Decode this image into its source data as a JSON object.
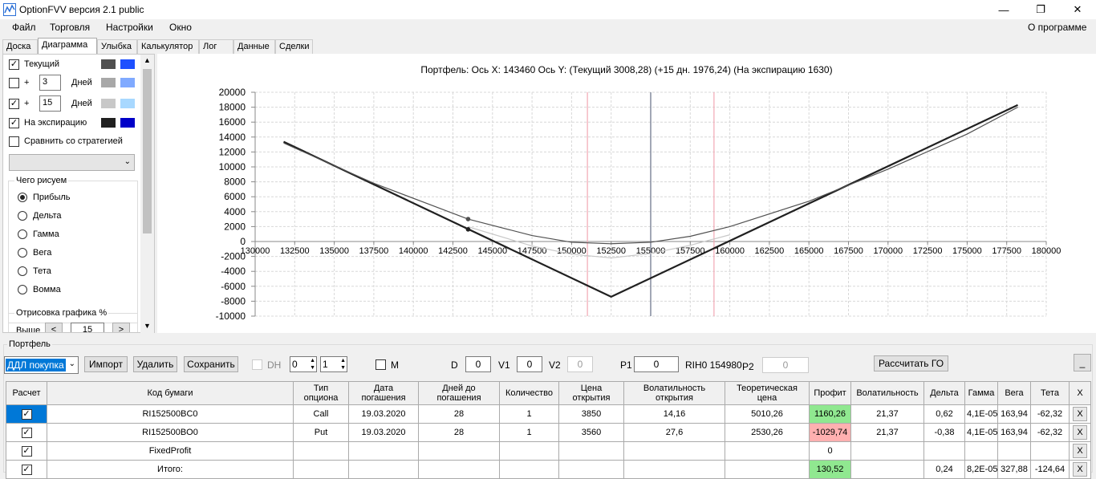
{
  "window": {
    "title": "OptionFVV версия 2.1 public",
    "min": "—",
    "restore": "❐",
    "close": "✕"
  },
  "menu": {
    "items": [
      "Файл",
      "Торговля",
      "Настройки",
      "Окно"
    ],
    "about": "О программе"
  },
  "tabs": [
    "Доска",
    "Диаграмма",
    "Улыбка",
    "Калькулятор",
    "Лог",
    "Данные",
    "Сделки"
  ],
  "left": {
    "current_label": "Текущий",
    "plus": "+",
    "days_label": "Дней",
    "days1": "3",
    "days2": "15",
    "expiry_label": "На экспирацию",
    "compare_label": "Сравнить со стратегией",
    "draw_group": "Чего рисуем",
    "radios": [
      "Прибыль",
      "Дельта",
      "Гамма",
      "Вега",
      "Тета",
      "Вомма"
    ],
    "render_group": "Отрисовка графика %",
    "above_label": "Выше",
    "above_value": "15",
    "lt": "<",
    "gt": ">"
  },
  "colors": {
    "cur_dark": "#505050",
    "cur_light": "#1e50ff",
    "d3_dark": "#a8a8a8",
    "d3_light": "#80aaff",
    "d15_dark": "#c8c8c8",
    "d15_light": "#a8d8ff",
    "exp_dark": "#202020",
    "exp_light": "#0000c8",
    "profit_pos": "#90e890",
    "profit_neg": "#ffb0b0",
    "select_blue": "#0078d7"
  },
  "chart_data": {
    "type": "line",
    "title": "Портфель: Ось X: 143460 Ось Y:  (Текущий 3008,28)  (+15 дн. 1976,24)  (На экспирацию 1630)",
    "xlim": [
      130000,
      180000
    ],
    "ylim": [
      -10000,
      20000
    ],
    "xticks": [
      130000,
      132500,
      135000,
      137500,
      140000,
      142500,
      145000,
      147500,
      150000,
      152500,
      155000,
      157500,
      160000,
      162500,
      165000,
      167500,
      170000,
      172500,
      175000,
      177500,
      180000
    ],
    "yticks": [
      20000,
      18000,
      16000,
      14000,
      12000,
      10000,
      8000,
      6000,
      4000,
      2000,
      0,
      -2000,
      -4000,
      -6000,
      -8000,
      -10000
    ],
    "grid": true,
    "cursor_x": 143460,
    "current_price_x": 155000,
    "vlines": [
      151000,
      159000
    ],
    "series": [
      {
        "name": "На экспирацию",
        "x": [
          131800,
          152500,
          178200
        ],
        "y": [
          13370,
          -7410,
          18290
        ]
      },
      {
        "name": "Текущий",
        "x": [
          131800,
          137500,
          143460,
          147500,
          150000,
          152500,
          155000,
          157500,
          160000,
          165000,
          170000,
          175000,
          178200
        ],
        "y": [
          13200,
          7800,
          3008,
          800,
          -100,
          -300,
          -100,
          700,
          2000,
          5400,
          9700,
          14400,
          18000
        ]
      },
      {
        "name": "+15 дн.",
        "x": [
          143460,
          147500,
          150000,
          152500,
          155000,
          157500,
          160000
        ],
        "y": [
          1976,
          -600,
          -1700,
          -2200,
          -1600,
          -500,
          900
        ]
      }
    ],
    "markers": [
      {
        "x": 143460,
        "y": 3008
      },
      {
        "x": 143460,
        "y": 1630
      }
    ]
  },
  "portfolio": {
    "group_label": "Портфель",
    "dropdown": "ДДЛ покупка",
    "import": "Импорт",
    "delete": "Удалить",
    "save": "Сохранить",
    "dh_label": "DH",
    "spin1": "0",
    "spin2": "1",
    "m_label": "M",
    "d_label": "D",
    "d_value": "0",
    "v1_label": "V1",
    "v1_value": "0",
    "v2_label": "V2",
    "v2_value": "0",
    "p1_label": "P1",
    "p1_value": "0",
    "instrument": "RIH0 154980",
    "p2_label": "P2",
    "p2_value": "0",
    "calc_go": "Рассчитать ГО",
    "min_btn": "_"
  },
  "table": {
    "headers": [
      "Расчет",
      "Код бумаги",
      "Тип опциона",
      "Дата погашения",
      "Дней до погашения",
      "Количество",
      "Цена открытия",
      "Волатильность открытия",
      "Теоретическая цена",
      "Профит",
      "Волатильность",
      "Дельта",
      "Гамма",
      "Вега",
      "Тета",
      "X"
    ],
    "rows": [
      [
        "✓",
        "RI152500BC0",
        "Call",
        "19.03.2020",
        "28",
        "1",
        "3850",
        "14,16",
        "5010,26",
        "1160,26",
        "21,37",
        "0,62",
        "4,1E-05",
        "163,94",
        "-62,32",
        "X"
      ],
      [
        "✓",
        "RI152500BO0",
        "Put",
        "19.03.2020",
        "28",
        "1",
        "3560",
        "27,6",
        "2530,26",
        "-1029,74",
        "21,37",
        "-0,38",
        "4,1E-05",
        "163,94",
        "-62,32",
        "X"
      ],
      [
        "✓",
        "FixedProfit",
        "",
        "",
        "",
        "",
        "",
        "",
        "",
        "0",
        "",
        "",
        "",
        "",
        "",
        "X"
      ],
      [
        "✓",
        "Итого:",
        "",
        "",
        "",
        "",
        "",
        "",
        "",
        "130,52",
        "",
        "0,24",
        "8,2E-05",
        "327,88",
        "-124,64",
        "X"
      ]
    ]
  }
}
